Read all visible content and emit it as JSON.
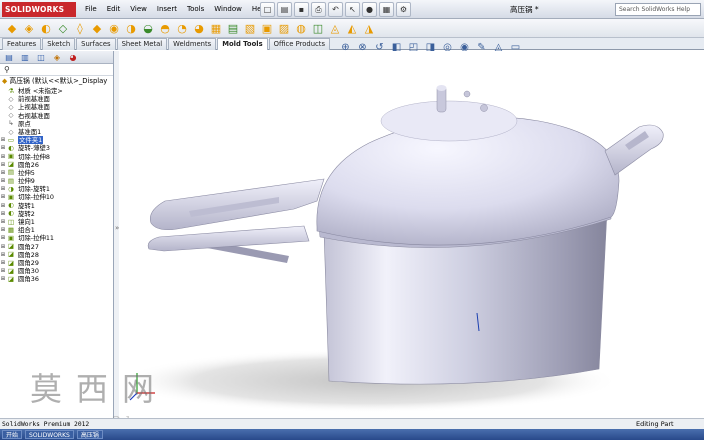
{
  "app": {
    "name": "SOLIDWORKS",
    "document_title": "高压锅 *"
  },
  "menus": [
    "File",
    "Edit",
    "View",
    "Insert",
    "Tools",
    "Window",
    "Help"
  ],
  "search": {
    "placeholder": "Search SolidWorks Help"
  },
  "tabs": [
    {
      "label": "Features",
      "active": false
    },
    {
      "label": "Sketch",
      "active": false
    },
    {
      "label": "Surfaces",
      "active": false
    },
    {
      "label": "Sheet Metal",
      "active": false
    },
    {
      "label": "Weldments",
      "active": false
    },
    {
      "label": "Mold Tools",
      "active": true
    },
    {
      "label": "Office Products",
      "active": false
    }
  ],
  "tree": {
    "root": "高压锅  (默认<<默认>_Display",
    "items": [
      {
        "label": "材质 <未指定>",
        "icon": "material-icon",
        "selected": false
      },
      {
        "label": "前视基准面",
        "icon": "plane-icon",
        "selected": false
      },
      {
        "label": "上视基准面",
        "icon": "plane-icon",
        "selected": false
      },
      {
        "label": "右视基准面",
        "icon": "plane-icon",
        "selected": false
      },
      {
        "label": "原点",
        "icon": "origin-icon",
        "selected": false
      },
      {
        "label": "基准面1",
        "icon": "plane-icon",
        "selected": false
      },
      {
        "label": "文件夹1",
        "icon": "folder-icon",
        "selected": true
      },
      {
        "label": "旋转-薄壁3",
        "icon": "revolve-icon",
        "selected": false
      },
      {
        "label": "切除-拉伸8",
        "icon": "cut-extrude-icon",
        "selected": false
      },
      {
        "label": "圆角26",
        "icon": "fillet-icon",
        "selected": false
      },
      {
        "label": "拉伸5",
        "icon": "extrude-icon",
        "selected": false
      },
      {
        "label": "拉伸9",
        "icon": "extrude-icon",
        "selected": false
      },
      {
        "label": "切除-旋转1",
        "icon": "cut-revolve-icon",
        "selected": false
      },
      {
        "label": "切除-拉伸10",
        "icon": "cut-extrude-icon",
        "selected": false
      },
      {
        "label": "旋转1",
        "icon": "revolve-icon",
        "selected": false
      },
      {
        "label": "旋转2",
        "icon": "revolve-icon",
        "selected": false
      },
      {
        "label": "镜向1",
        "icon": "mirror-icon",
        "selected": false
      },
      {
        "label": "组合1",
        "icon": "combine-icon",
        "selected": false
      },
      {
        "label": "切除-拉伸11",
        "icon": "cut-extrude-icon",
        "selected": false
      },
      {
        "label": "圆角27",
        "icon": "fillet-icon",
        "selected": false
      },
      {
        "label": "圆角28",
        "icon": "fillet-icon",
        "selected": false
      },
      {
        "label": "圆角29",
        "icon": "fillet-icon",
        "selected": false
      },
      {
        "label": "圆角30",
        "icon": "fillet-icon",
        "selected": false
      },
      {
        "label": "圆角36",
        "icon": "fillet-icon",
        "selected": false
      }
    ]
  },
  "status": {
    "left": "SolidWorks Premium 2012",
    "right": "Editing Part"
  },
  "taskbar": {
    "items": [
      "开始",
      "SOLIDWORKS",
      "高压锅"
    ]
  },
  "watermark": {
    "text": "莫西网",
    "url": "www.3dmox.com"
  },
  "colors": {
    "accent": "#c9272b",
    "selection": "#3264c8",
    "model": "#dcdef0"
  }
}
